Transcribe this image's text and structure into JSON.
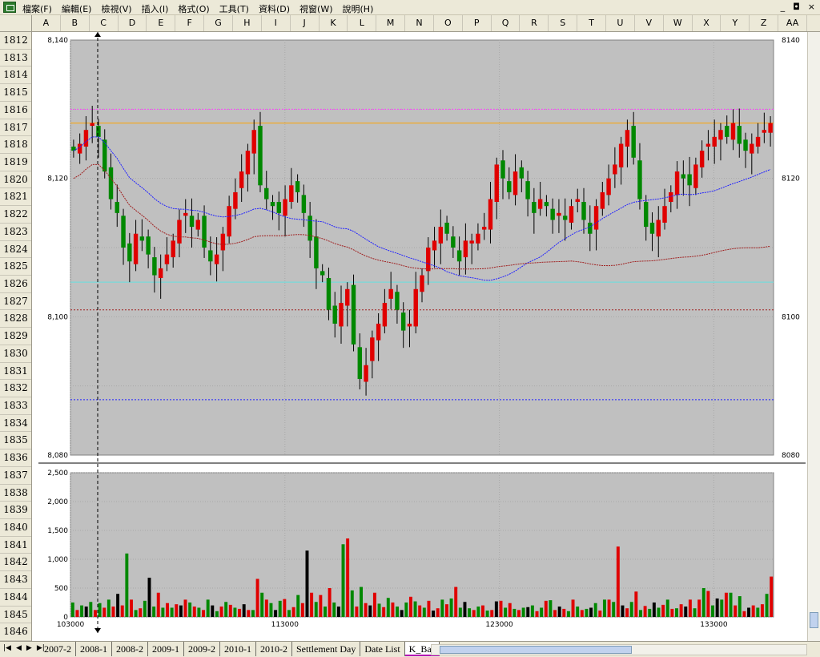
{
  "menubar": {
    "items": [
      "檔案(F)",
      "編輯(E)",
      "檢視(V)",
      "插入(I)",
      "格式(O)",
      "工具(T)",
      "資料(D)",
      "視窗(W)",
      "說明(H)"
    ],
    "minimize_glyph": "_",
    "restore_glyph": "◘",
    "close_glyph": "×"
  },
  "columns": [
    "A",
    "B",
    "C",
    "D",
    "E",
    "F",
    "G",
    "H",
    "I",
    "J",
    "K",
    "L",
    "M",
    "N",
    "O",
    "P",
    "Q",
    "R",
    "S",
    "T",
    "U",
    "V",
    "W",
    "X",
    "Y",
    "Z",
    "AA"
  ],
  "rows": [
    "1812",
    "1813",
    "1814",
    "1815",
    "1816",
    "1817",
    "1818",
    "1819",
    "1820",
    "1821",
    "1822",
    "1823",
    "1824",
    "1825",
    "1826",
    "1827",
    "1828",
    "1829",
    "1830",
    "1831",
    "1832",
    "1833",
    "1834",
    "1835",
    "1836",
    "1837",
    "1838",
    "1839",
    "1840",
    "1841",
    "1842",
    "1843",
    "1844",
    "1845",
    "1846"
  ],
  "sheet_tabs": [
    "2007-2",
    "2008-1",
    "2008-2",
    "2009-1",
    "2009-2",
    "2010-1",
    "2010-2",
    "Settlement Day",
    "Date List",
    "K_Bar"
  ],
  "active_tab": "K_Bar",
  "colors": {
    "up_bar": "#e00000",
    "down_bar": "#008800",
    "plot_bg": "#c0c0c0",
    "ma_short": "#2020ff",
    "ma_long": "#a02020",
    "ref_magenta": "#ff44ff",
    "ref_orange": "#ffa500",
    "ref_cyan": "#66e0e0",
    "ref_blue": "#2020ff"
  },
  "chart_data": [
    {
      "type": "candlestick",
      "title": "",
      "y_left_ticks": [
        "8,140",
        "8,120",
        "8,100",
        "8,080"
      ],
      "y_right_ticks": [
        "8140",
        "8120",
        "8100",
        "8080"
      ],
      "ylim": [
        8080,
        8140
      ],
      "x_ticks": [
        "103000",
        "113000",
        "123000",
        "133000"
      ],
      "reference_lines": [
        {
          "color": "magenta",
          "y": 8130
        },
        {
          "color": "orange",
          "y": 8128
        },
        {
          "color": "cyan",
          "y": 8105
        },
        {
          "color": "brown",
          "y": 8101
        },
        {
          "color": "blue",
          "y": 8088
        }
      ],
      "points": [
        8124,
        8125,
        8127,
        8128,
        8126,
        8121,
        8117,
        8115,
        8110,
        8108,
        8112,
        8111,
        8109,
        8106,
        8107,
        8109,
        8111,
        8114,
        8115,
        8113,
        8114,
        8110,
        8108,
        8109,
        8112,
        8116,
        8118,
        8121,
        8124,
        8127,
        8119,
        8117,
        8116,
        8115,
        8117,
        8119,
        8118,
        8115,
        8111,
        8107,
        8106,
        8101,
        8099,
        8102,
        8104,
        8096,
        8091,
        8093,
        8097,
        8099,
        8102,
        8104,
        8101,
        8098,
        8099,
        8104,
        8106,
        8110,
        8111,
        8113,
        8112,
        8110,
        8108,
        8111,
        8111,
        8112,
        8113,
        8117,
        8122,
        8120,
        8118,
        8121,
        8120,
        8117,
        8115,
        8117,
        8116,
        8114,
        8115,
        8114,
        8116,
        8117,
        8114,
        8112,
        8116,
        8118,
        8120,
        8122,
        8125,
        8127,
        8123,
        8117,
        8113,
        8112,
        8114,
        8116,
        8118,
        8121,
        8120,
        8119,
        8122,
        8124,
        8125,
        8126,
        8127,
        8126,
        8128,
        8125,
        8124,
        8125,
        8126,
        8127,
        8128
      ]
    },
    {
      "type": "bar",
      "title": "",
      "y_ticks": [
        "2,500",
        "2,000",
        "1,500",
        "1,000",
        "500",
        "0"
      ],
      "ylim": [
        0,
        2500
      ],
      "x_ticks": [
        "103000",
        "113000",
        "123000",
        "133000"
      ],
      "values": [
        250,
        120,
        200,
        180,
        260,
        120,
        240,
        160,
        300,
        180,
        400,
        200,
        1100,
        300,
        120,
        150,
        280,
        680,
        180,
        420,
        160,
        240,
        160,
        220,
        200,
        300,
        250,
        180,
        160,
        120,
        300,
        200,
        100,
        180,
        260,
        210,
        160,
        140,
        220,
        120,
        120,
        660,
        420,
        300,
        240,
        120,
        280,
        310,
        120,
        170,
        380,
        240,
        1150,
        420,
        260,
        380,
        180,
        500,
        250,
        180,
        1260,
        1360,
        460,
        180,
        520,
        240,
        200,
        420,
        230,
        170,
        330,
        250,
        180,
        120,
        250,
        350,
        270,
        200,
        160,
        280,
        110,
        150,
        300,
        220,
        320,
        520,
        160,
        260,
        150,
        120,
        180,
        200,
        110,
        120,
        270,
        280,
        160,
        240,
        140,
        120,
        160,
        170,
        200,
        100,
        160,
        280,
        290,
        120,
        180,
        140,
        100,
        300,
        180,
        120,
        140,
        160,
        240,
        110,
        300,
        300,
        260,
        1220,
        200,
        150,
        260,
        440,
        120,
        190,
        140,
        250,
        160,
        210,
        300,
        140,
        150,
        220,
        180,
        300,
        150,
        300,
        500,
        450,
        200,
        320,
        300,
        420,
        420,
        200,
        360,
        100,
        160,
        200,
        160,
        220,
        400,
        700
      ]
    }
  ]
}
